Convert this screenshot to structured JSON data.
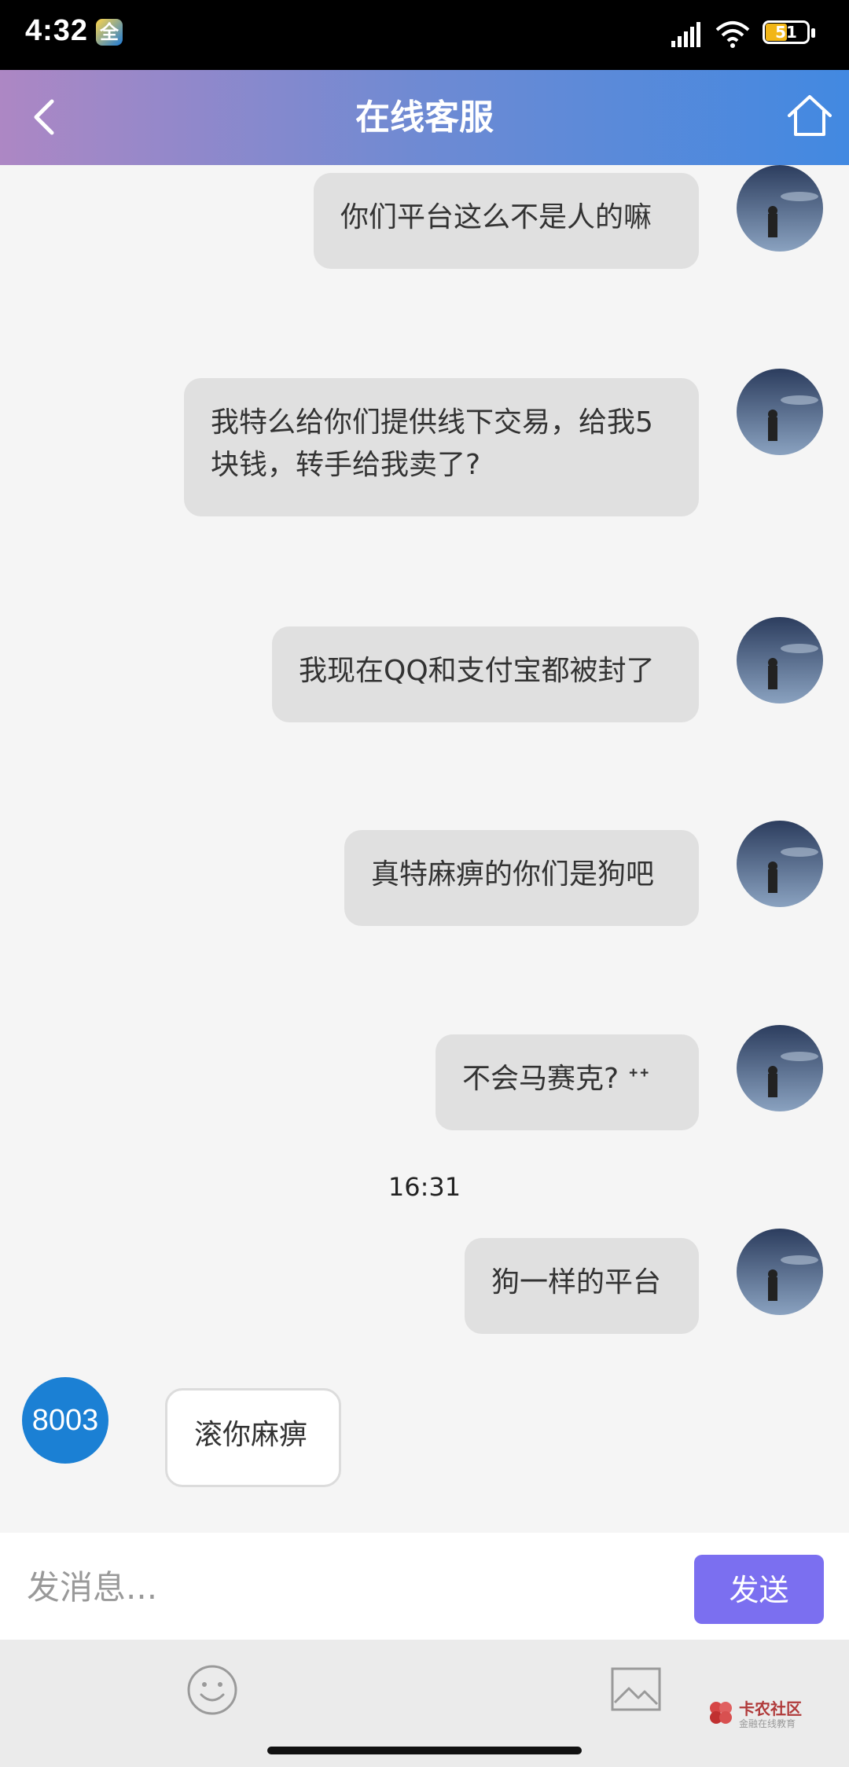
{
  "status_bar": {
    "time": "4:32",
    "app_badge": "全",
    "battery": "51"
  },
  "header": {
    "title": "在线客服"
  },
  "messages": [
    {
      "side": "out",
      "text": "你们平台这么不是人的嘛"
    },
    {
      "side": "out",
      "text": "我特么给你们提供线下交易，给我5块钱，转手给我卖了?"
    },
    {
      "side": "out",
      "text": "我现在QQ和支付宝都被封了"
    },
    {
      "side": "out",
      "text": "真特麻痹的你们是狗吧"
    },
    {
      "side": "out",
      "text": "不会马赛克? ᐩᐩ"
    },
    {
      "side": "out",
      "text": "狗一样的平台"
    },
    {
      "side": "in",
      "agent": "8003",
      "text": "滚你麻痹"
    }
  ],
  "timestamp": "16:31",
  "composer": {
    "placeholder": "发消息...",
    "send_label": "发送"
  },
  "watermark": {
    "title": "卡农社区",
    "subtitle": "金融在线教育"
  },
  "colors": {
    "header_gradient": [
      "#ad87c4",
      "#4289e1"
    ],
    "send_button": "#7b6ff0",
    "agent_avatar": "#1b80d4",
    "bubble_out": "#e0e0e0"
  }
}
